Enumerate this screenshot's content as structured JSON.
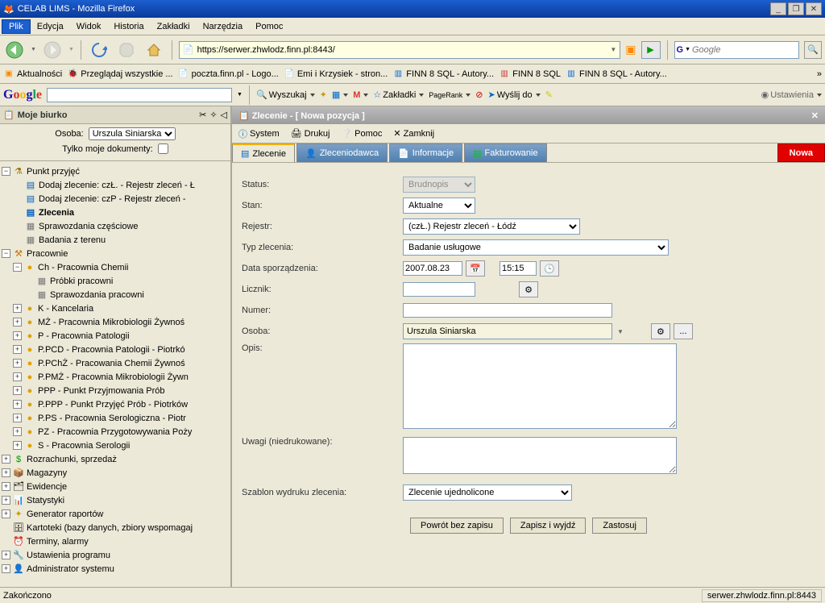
{
  "window": {
    "title": "CELAB LIMS - Mozilla Firefox"
  },
  "menubar": [
    "Plik",
    "Edycja",
    "Widok",
    "Historia",
    "Zakładki",
    "Narzędzia",
    "Pomoc"
  ],
  "url": "https://serwer.zhwlodz.finn.pl:8443/",
  "search_engine": "Google",
  "search_value": "",
  "bookmarks": [
    "Aktualności",
    "Przeglądaj wszystkie ...",
    "poczta.finn.pl - Logo...",
    "Emi i Krzysiek - stron...",
    "FINN 8 SQL - Autory...",
    "FINN 8 SQL",
    "FINN 8 SQL - Autory..."
  ],
  "gtoolbar": {
    "search": "Wyszukaj",
    "bookmarks": "Zakładki",
    "pagerank": "PageRank",
    "send": "Wyślij do",
    "settings": "Ustawienia"
  },
  "left": {
    "title": "Moje biurko",
    "osoba_label": "Osoba:",
    "osoba_value": "Urszula Siniarska",
    "only_mine": "Tylko moje dokumenty:",
    "tree": {
      "punkt": "Punkt przyjęć",
      "dodajL": "Dodaj zlecenie: czŁ. - Rejestr zleceń - Ł",
      "dodajP": "Dodaj zlecenie: czP - Rejestr zleceń -",
      "zlecenia": "Zlecenia",
      "spraw": "Sprawozdania częściowe",
      "badter": "Badania z terenu",
      "pracownie": "Pracownie",
      "ch": "Ch - Pracownia Chemii",
      "probki": "Próbki pracowni",
      "sprawp": "Sprawozdania pracowni",
      "k": "K - Kancelaria",
      "mz": "MŻ - Pracownia Mikrobiologii Żywnoś",
      "p": "P - Pracownia Patologii",
      "pcd": "P.PCD - Pracownia Patologii - Piotrkó",
      "pchz": "P.PChŻ - Pracowania Chemii Żywnoś",
      "pmz": "P.PMŻ - Pracownia Mikrobiologii Żywn",
      "ppp": "PPP - Punkt Przyjmowania Prób",
      "pppp": "P.PPP - Punkt Przyjęć Prób - Piotrków",
      "pps": "P.PS - Pracownia Serologiczna - Piotr",
      "pz": "PZ - Pracownia Przygotowywania Poży",
      "s": "S - Pracownia Serologii",
      "roz": "Rozrachunki, sprzedaż",
      "mag": "Magazyny",
      "ewi": "Ewidencje",
      "stat": "Statystyki",
      "gen": "Generator raportów",
      "kart": "Kartoteki (bazy danych, zbiory wspomagaj",
      "term": "Terminy, alarmy",
      "ust": "Ustawienia programu",
      "adm": "Administrator systemu"
    }
  },
  "right": {
    "title": "Zlecenie - [ Nowa pozycja ]",
    "menu": {
      "system": "System",
      "drukuj": "Drukuj",
      "pomoc": "Pomoc",
      "zamknij": "Zamknij"
    },
    "tabs": {
      "zlecenie": "Zlecenie",
      "zleceniodawca": "Zleceniodawca",
      "informacje": "Informacje",
      "fakturowanie": "Fakturowanie",
      "nowa": "Nowa"
    },
    "form": {
      "status_l": "Status:",
      "status_v": "Brudnopis",
      "stan_l": "Stan:",
      "stan_v": "Aktualne",
      "rejestr_l": "Rejestr:",
      "rejestr_v": "(czŁ.) Rejestr zleceń - Łódź",
      "typ_l": "Typ zlecenia:",
      "typ_v": "Badanie usługowe",
      "data_l": "Data sporządzenia:",
      "data_v": "2007.08.23",
      "time_v": "15:15",
      "licznik_l": "Licznik:",
      "numer_l": "Numer:",
      "osoba_l": "Osoba:",
      "osoba_v": "Urszula Siniarska",
      "opis_l": "Opis:",
      "uwagi_l": "Uwagi (niedrukowane):",
      "szablon_l": "Szablon wydruku zlecenia:",
      "szablon_v": "Zlecenie ujednolicone",
      "btn_back": "Powrót bez zapisu",
      "btn_save": "Zapisz i wyjdź",
      "btn_apply": "Zastosuj"
    }
  },
  "status": {
    "left": "Zakończono",
    "right": "serwer.zhwlodz.finn.pl:8443"
  }
}
